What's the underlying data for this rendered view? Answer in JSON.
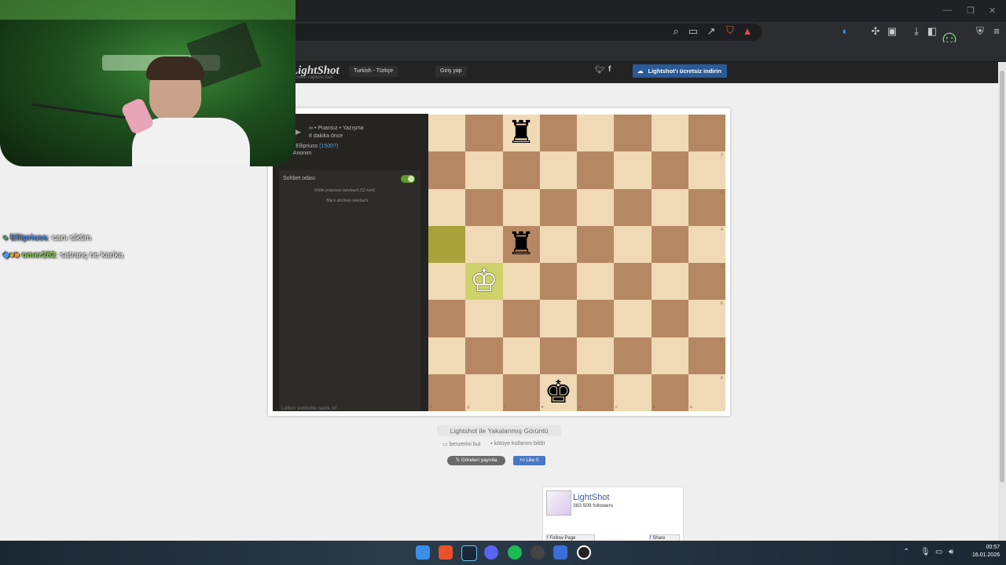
{
  "browser": {
    "toolbar_icons": [
      "zoom-icon",
      "cast-icon",
      "share-icon",
      "brave-shield-icon",
      "brave-rewards-icon",
      "extension-icon",
      "settings-icon",
      "puzzle-icon",
      "download-icon",
      "sidebar-icon",
      "wallet-icon",
      "menu-icon"
    ]
  },
  "site": {
    "logo": "LightShot",
    "logo_sub": "screen capture tool",
    "language": "Turkish - Türkçe",
    "login": "Giriş yap",
    "download": "Lightshot'ı ücretsiz indirin",
    "caption": "Lightshot ile Yakalanmış Görüntü",
    "find_similar": "benzerini bul",
    "report": "kötüye kullanım bildir",
    "tweet": "Gönderi yayınla",
    "like": "Like 0",
    "fb": {
      "name": "LightShot",
      "followers": "383.509 followers",
      "follow": "Follow Page",
      "share": "Share"
    }
  },
  "chess": {
    "game_line": "∞ • Puansız • Yazışma",
    "time_ago": "8 dakika önce",
    "player_white_name": "Ellipriuss",
    "player_white_rating": "(1500?)",
    "player_black": "Anonim",
    "chat_title": "Sohbet odası",
    "msg1": "White proposes takeback (52.Ke4)",
    "msg2": "Black declines takeback",
    "chat_placeholder": "Lütfen sohbette nazik ol!",
    "ranks": [
      "1",
      "2",
      "3",
      "4",
      "5",
      "6",
      "7",
      "8"
    ],
    "files": [
      "h",
      "g",
      "f",
      "e",
      "d",
      "c",
      "b",
      "a"
    ],
    "pieces": [
      {
        "glyph": "♜",
        "name": "black-rook-piece",
        "col": 2,
        "row": 0
      },
      {
        "glyph": "♜",
        "name": "black-rook-piece",
        "col": 2,
        "row": 3
      },
      {
        "glyph": "♔",
        "name": "white-king-piece",
        "col": 1,
        "row": 4
      },
      {
        "glyph": "♚",
        "name": "black-king-piece",
        "col": 3,
        "row": 7
      }
    ]
  },
  "stream_chat": [
    {
      "user": "Ellipriuss",
      "msg": ": canı siktim",
      "color": "#4a86e8"
    },
    {
      "user": "omer282",
      "msg": ": satranç ne kanka",
      "color": "#7fd34a"
    }
  ],
  "taskbar": {
    "time": "00:57",
    "date": "16.01.2026"
  }
}
